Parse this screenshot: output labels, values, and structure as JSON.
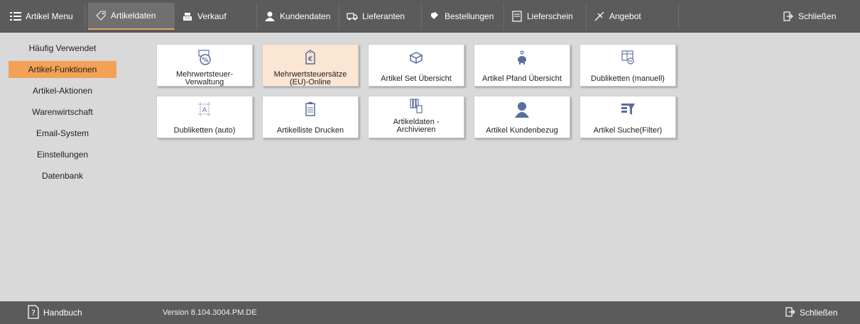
{
  "topbar": {
    "tabs": [
      {
        "label": "Artikel Menu",
        "icon": "menu-list-icon"
      },
      {
        "label": "Artikeldaten",
        "icon": "tag-icon",
        "active": true
      },
      {
        "label": "Verkauf",
        "icon": "cash-register-icon"
      },
      {
        "label": "Kundendaten",
        "icon": "person-icon"
      },
      {
        "label": "Lieferanten",
        "icon": "truck-icon"
      },
      {
        "label": "Bestellungen",
        "icon": "order-icon"
      },
      {
        "label": "Lieferschein",
        "icon": "document-icon"
      },
      {
        "label": "Angebot",
        "icon": "offer-icon"
      }
    ],
    "close_label": "Schließen"
  },
  "sidebar": {
    "items": [
      {
        "label": "Häufig Verwendet"
      },
      {
        "label": "Artikel-Funktionen",
        "active": true
      },
      {
        "label": "Artikel-Aktionen"
      },
      {
        "label": "Warenwirtschaft"
      },
      {
        "label": "Email-System"
      },
      {
        "label": "Einstellungen"
      },
      {
        "label": "Datenbank"
      }
    ]
  },
  "tiles": [
    {
      "line1": "Mehrwertsteuer-",
      "line2": "Verwaltung",
      "icon": "percent-icon"
    },
    {
      "line1": "Mehrwertsteuersätze",
      "line2": "(EU)-Online",
      "icon": "euro-icon",
      "highlighted": true
    },
    {
      "line1": "Artikel Set Übersicht",
      "line2": "",
      "icon": "box-icon"
    },
    {
      "line1": "Artikel Pfand Übersicht",
      "line2": "",
      "icon": "piggy-bank-icon"
    },
    {
      "line1": "Dubliketten (manuell)",
      "line2": "",
      "icon": "duplicate-table-icon"
    },
    {
      "line1": "Dubliketten (auto)",
      "line2": "",
      "icon": "duplicate-auto-icon"
    },
    {
      "line1": "Artikelliste Drucken",
      "line2": "",
      "icon": "clipboard-icon"
    },
    {
      "line1": "Artikeldaten -",
      "line2": "Archivieren",
      "icon": "archive-icon"
    },
    {
      "line1": "Artikel Kundenbezug",
      "line2": "",
      "icon": "customer-icon"
    },
    {
      "line1": "Artikel Suche(Filter)",
      "line2": "",
      "icon": "filter-icon"
    }
  ],
  "bottombar": {
    "help_label": "Handbuch",
    "version": "Version 8.104.3004.PM.DE",
    "close_label": "Schließen"
  },
  "colors": {
    "accent": "#f3a255",
    "bar": "#5b5b5b",
    "tile_highlight": "#fbe5d3",
    "icon": "#5a6e9c"
  }
}
